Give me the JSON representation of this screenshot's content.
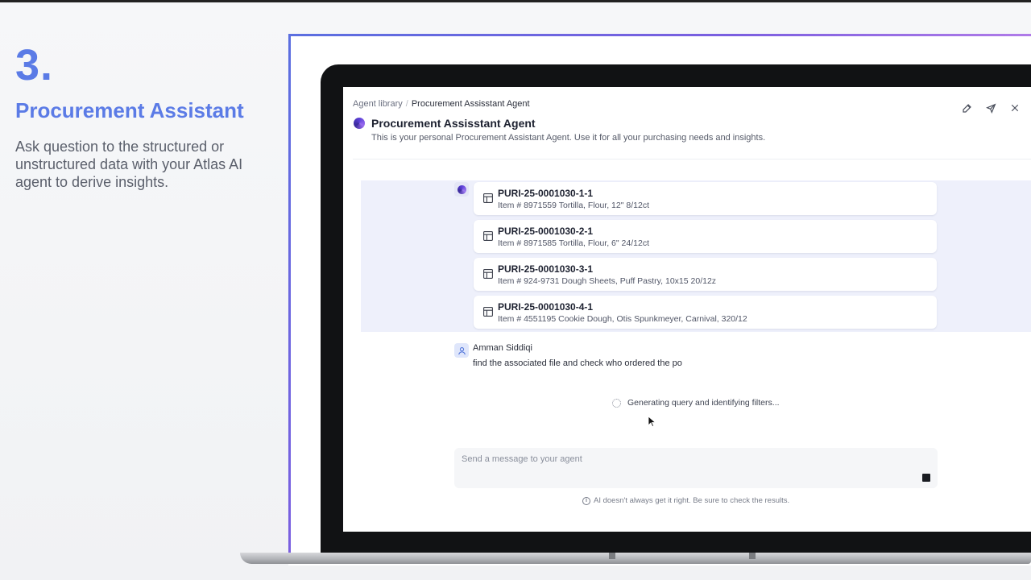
{
  "intro": {
    "step": "3.",
    "title": "Procurement Assistant",
    "description": "Ask question to the structured or unstructured data with your Atlas AI agent to derive insights."
  },
  "app": {
    "breadcrumb": {
      "root": "Agent library",
      "current": "Procurement Assisstant Agent"
    },
    "agent": {
      "title": "Procurement Assisstant Agent",
      "description": "This is your personal Procurement Assistant Agent. Use it for all your purchasing needs and insights."
    },
    "results": [
      {
        "id": "PURI-25-0001030-1-1",
        "item": "Item # 8971559 Tortilla, Flour, 12\" 8/12ct"
      },
      {
        "id": "PURI-25-0001030-2-1",
        "item": "Item # 8971585 Tortilla, Flour, 6\" 24/12ct"
      },
      {
        "id": "PURI-25-0001030-3-1",
        "item": "Item # 924-9731 Dough Sheets, Puff Pastry, 10x15 20/12z"
      },
      {
        "id": "PURI-25-0001030-4-1",
        "item": "Item # 4551195 Cookie Dough, Otis Spunkmeyer, Carnival, 320/12"
      }
    ],
    "user_message": {
      "name": "Amman Siddiqi",
      "text": "find the associated file and check who ordered the po"
    },
    "status": "Generating query and identifying filters...",
    "composer": {
      "placeholder": "Send a message to your agent",
      "value": ""
    },
    "disclaimer": "AI doesn't always get it right. Be sure to check the results."
  },
  "colors": {
    "accent": "#5b7be6",
    "results_band": "#eef0fb",
    "frame_gradient": [
      "#5b6fe0",
      "#b07be8"
    ]
  },
  "icons": {
    "header": [
      "edit-icon",
      "send-icon",
      "close-icon"
    ],
    "result": "table-icon",
    "status": "spinner-icon",
    "disclaimer": "info-icon"
  }
}
